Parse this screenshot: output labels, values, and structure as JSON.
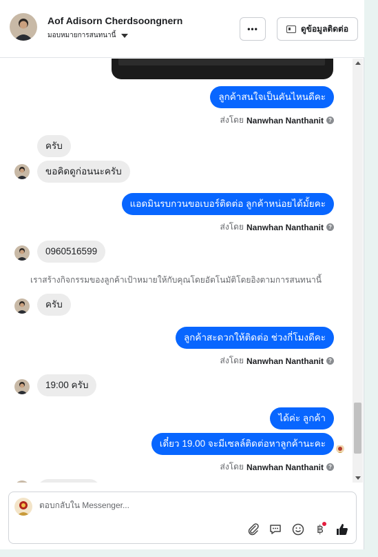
{
  "header": {
    "contact_name": "Aof Adisorn Cherdsoongnern",
    "assign_label": "มอบหมายการสนทนานี้",
    "more_label": "•••",
    "view_contact_label": "ดูข้อมูลติดต่อ"
  },
  "messages": {
    "m1": "ลูกค้าสนใจเป็นคันไหนดีคะ",
    "m2": "ครับ",
    "m3": "ขอคิดดูก่อนนะครับ",
    "m4": "แอดมินรบกวนขอเบอร์ติดต่อ ลูกค้าหน่อยได้มั้ยคะ",
    "m5": "0960516599",
    "system": "เราสร้างกิจกรรมของลูกค้าเป้าหมายให้กับคุณโดยอัตโนมัติโดยอิงตามการสนทนานี้",
    "m6": "ครับ",
    "m7": "ลูกค้าสะดวกให้ติดต่อ ช่วงกี่โมงดีคะ",
    "m8": "19:00 ครับ",
    "m9": "ได้ค่ะ ลูกค้า",
    "m10": "เดี๋ยว 19.00 จะมีเซลล์ติดต่อหาลูกค้านะคะ"
  },
  "sent_by": {
    "prefix": "ส่งโดย",
    "sender": "Nanwhan Nanthanit"
  },
  "composer": {
    "placeholder": "ตอบกลับใน Messenger..."
  },
  "icons": [
    "attach-icon",
    "saved-reply-icon",
    "emoji-icon",
    "baht-icon",
    "like-icon"
  ],
  "colors": {
    "outgoing_bubble": "#0866ff",
    "incoming_bubble": "#ececec",
    "notification_dot": "#e41e3f"
  }
}
